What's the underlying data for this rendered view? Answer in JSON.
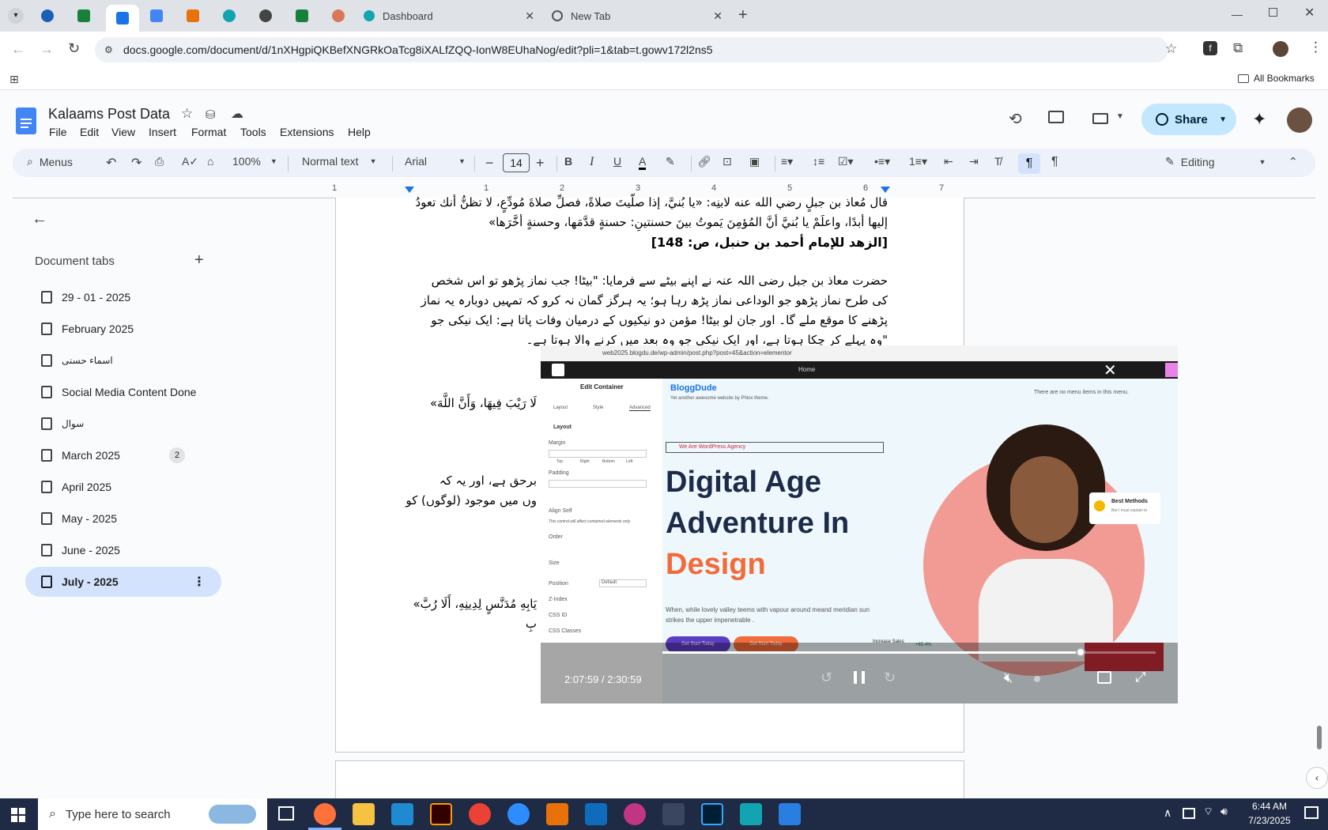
{
  "browser": {
    "tabs": [
      {
        "label": "Dashboard"
      },
      {
        "label": "New Tab"
      }
    ],
    "url": "docs.google.com/document/d/1nXHgpiQKBefXNGRkOaTcg8iXALfZQQ-IonW8EUhaNog/edit?pli=1&tab=t.gowv172l2ns5",
    "bookmarks_label": "All Bookmarks"
  },
  "doc": {
    "title": "Kalaams Post Data",
    "menus": [
      "File",
      "Edit",
      "View",
      "Insert",
      "Format",
      "Tools",
      "Extensions",
      "Help"
    ],
    "share_label": "Share",
    "toolbar": {
      "search": "Menus",
      "zoom": "100%",
      "style": "Normal text",
      "font": "Arial",
      "size": "14",
      "mode": "Editing"
    },
    "ruler_ticks": [
      "1",
      "1",
      "2",
      "3",
      "4",
      "5",
      "6",
      "7"
    ]
  },
  "sidebar": {
    "heading": "Document tabs",
    "items": [
      {
        "label": "29 - 01 - 2025"
      },
      {
        "label": "February 2025"
      },
      {
        "label": "اسماء حسنی"
      },
      {
        "label": "Social Media Content Done"
      },
      {
        "label": "سوال"
      },
      {
        "label": "March 2025",
        "badge": "2"
      },
      {
        "label": "April 2025"
      },
      {
        "label": "May - 2025"
      },
      {
        "label": "June - 2025"
      },
      {
        "label": "July - 2025"
      }
    ]
  },
  "page": {
    "lines": [
      "قال مُعاذ بن جبلٍ رضي الله عنه لابنِه: «يا بُنيَّ، إذا صلَّيتَ صلاةً، فصلِّ صلاةَ مُودِّعٍ، لا تظنُّ أنك تعودُ",
      "إليها أبدًا، واعلَمْ يا بُنيَّ أنَّ المُؤمِنَ يَموتُ بينَ حسنتينِ: حسنةٍ قدَّمَها، وحسنةٍ أخَّرَها»",
      "[الزهد للإمام أحمد بن حنبل، ص: 148]",
      "حضرت معاذ بن جبل رضی اللہ عنہ نے اپنے بیٹے سے فرمایا: \"بیٹا! جب نماز پڑھو تو اس شخص",
      "کی طرح نماز پڑھو جو الوداعی نماز پڑھ رہا ہو؛ یہ ہرگز گمان نہ کرو کہ تمہیں دوبارہ یہ نماز",
      "پڑھنے کا موقع ملے گا۔ اور جان لو بیٹا! مؤمن دو نیکیوں کے درمیان وفات پاتا ہے: ایک نیکی جو",
      "\"وہ پہلے کر چکا ہوتا ہے، اور ایک نیکی جو وہ بعد میں کرنے والا ہوتا ہے۔"
    ],
    "fragment1": "لَا رَيْبَ فِيهَا، وَأَنَّ اللَّهَ»",
    "fragment2": "برحق ہے، اور یہ کہ",
    "fragment3": "وں میں موجود (لوگوں) کو",
    "fragment4": "يَابِهِ مُدَنَّسٍ لِدِينِهِ، أَلَا رُبَّ»",
    "fragment5": "بِ"
  },
  "video": {
    "url": "web2025.blogdu.de/wp-admin/post.php?post=45&action=elementor",
    "editor_title": "Edit Container",
    "editor_tabs": [
      "Layout",
      "Style",
      "Advanced"
    ],
    "layout_heading": "Layout",
    "margin_label": "Margin",
    "padding_label": "Padding",
    "align_self_label": "Align Self",
    "order_label": "Order",
    "size_label": "Size",
    "position_label": "Position",
    "position_value": "Default",
    "zindex_label": "Z-Index",
    "cssid_label": "CSS ID",
    "cssclasses_label": "CSS Classes",
    "field_labels": [
      "Top",
      "Right",
      "Bottom",
      "Left"
    ],
    "note": "This control will affect contained elements only.",
    "home_label": "Home",
    "site_name": "BloggDude",
    "site_tagline": "Yet another awesome website by Phlox theme.",
    "menu_note": "There are no menu items in this menu.",
    "agency_tag": "We Are WordPress Agency",
    "hero_line1": "Digital Age",
    "hero_line2": "Adventure In",
    "hero_line3": "Design",
    "hero_body": "When, while lovely valley teems with vapour around meand meridian sun strikes the upper impenetrable .",
    "btn1": "Get Start Today",
    "btn2": "Get Start Today",
    "badge_title": "Best Methods",
    "badge_sub": "But I must explain to",
    "sales_label": "Increase Sales",
    "sales_value": "+65.4%",
    "time": "2:07:59 / 2:30:59",
    "progress": 0.847
  },
  "taskbar": {
    "search": "Type here to search",
    "time": "6:44 AM",
    "date": "7/23/2025"
  },
  "colors": {
    "accent": "#1a73e8",
    "selected": "#d3e3fd",
    "hero_navy": "#1c2b4a",
    "hero_orange": "#f26b3a",
    "hero_pink": "#f29b95"
  }
}
